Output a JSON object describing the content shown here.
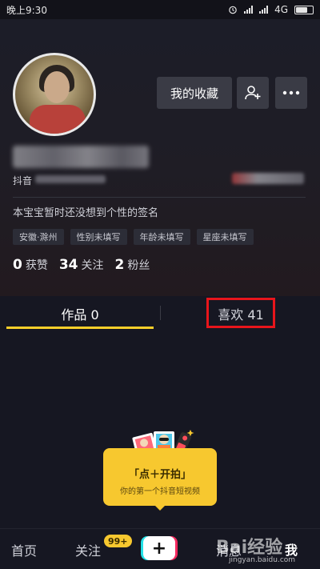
{
  "status_bar": {
    "time": "晚上9:30",
    "network": "4G"
  },
  "profile": {
    "id_prefix": "抖音",
    "signature": "本宝宝暂时还没想到个性的签名",
    "tags": [
      "安徽·滁州",
      "性别未填写",
      "年龄未填写",
      "星座未填写"
    ],
    "stats": [
      {
        "value": "0",
        "label": "获赞"
      },
      {
        "value": "34",
        "label": "关注"
      },
      {
        "value": "2",
        "label": "粉丝"
      }
    ]
  },
  "actions": {
    "favorites_label": "我的收藏"
  },
  "tabs": {
    "works": "作品 0",
    "likes": "喜欢 41"
  },
  "cta": {
    "title": "「点＋开拍」",
    "subtitle": "你的第一个抖音短视频"
  },
  "bottom_nav": {
    "home": "首页",
    "follow": "关注",
    "follow_badge": "99+",
    "plus": "+",
    "messages": "消息",
    "me": "我"
  },
  "watermark": {
    "text": "Bai经验",
    "url": "jingyan.baidu.com"
  },
  "colors": {
    "accent_yellow": "#facf2a",
    "highlight_red": "#e8151b",
    "background": "#161722"
  }
}
